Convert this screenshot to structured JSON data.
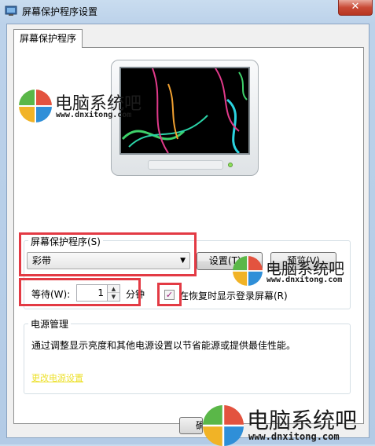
{
  "window": {
    "title": "屏幕保护程序设置",
    "close_glyph": "✕"
  },
  "tabs": [
    {
      "label": "屏幕保护程序",
      "selected": true
    }
  ],
  "screensaver": {
    "group_label": "屏幕保护程序(S)",
    "selected": "彩带",
    "settings_button": "设置(T)...",
    "preview_button": "预览(V)"
  },
  "wait": {
    "label": "等待(W):",
    "value": "1",
    "unit": "分钟",
    "resume_checkbox_label": "在恢复时显示登录屏幕(R)",
    "resume_checked": true
  },
  "power": {
    "group_label": "电源管理",
    "description": "通过调整显示亮度和其他电源设置以节省能源或提供最佳性能。",
    "link": "更改电源设置"
  },
  "footer": {
    "ok_partial": "确"
  },
  "watermarks": [
    {
      "name": "电脑系统吧",
      "url": "www.dnxitong.com"
    },
    {
      "name": "电脑系统吧",
      "url": "www.dnxitong.com"
    },
    {
      "name": "电脑系统吧",
      "url": "www.dnxitong.com"
    }
  ],
  "colors": {
    "highlight_box": "#e33a44",
    "link": "#ede130"
  }
}
